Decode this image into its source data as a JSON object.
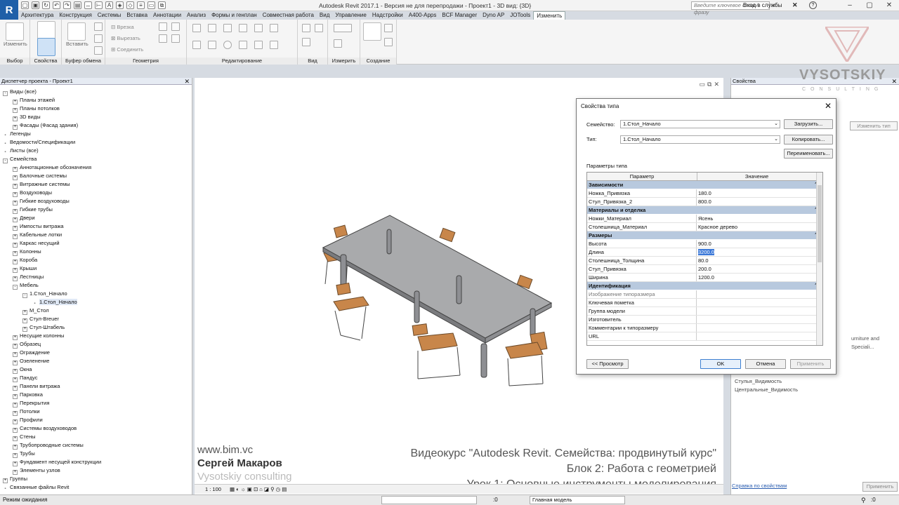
{
  "app": {
    "logo_letter": "R",
    "title": "Autodesk Revit 2017.1 - Версия не для перепродажи -   Проект1 - 3D вид: {3D}",
    "search_placeholder": "Введите ключевое слово/фразу",
    "login_label": "Вход в службы"
  },
  "ribbon": {
    "tabs": [
      "Архитектура",
      "Конструкция",
      "Системы",
      "Вставка",
      "Аннотации",
      "Анализ",
      "Формы и генплан",
      "Совместная работа",
      "Вид",
      "Управление",
      "Надстройки",
      "A400-Apps",
      "BCF Manager",
      "Dyno AP",
      "JOTools",
      "Изменить"
    ],
    "active_tab": "Изменить",
    "panels": {
      "select": "Выбор",
      "properties": "Свойства",
      "clipboard": "Буфер обмена",
      "geometry": "Геометрия",
      "modify": "Редактирование",
      "view": "Вид",
      "measure": "Измерить",
      "create": "Создание"
    },
    "buttons": {
      "modify": "Изменить",
      "paste": "Вставить",
      "cut_in": "Врезка",
      "cut": "Вырезать",
      "join": "Соединить"
    }
  },
  "browser": {
    "title": "Диспетчер проекта - Проект1",
    "nodes": [
      {
        "label": "Виды (все)",
        "level": 0,
        "exp": "-"
      },
      {
        "label": "Планы этажей",
        "level": 1,
        "exp": "+"
      },
      {
        "label": "Планы потолков",
        "level": 1,
        "exp": "+"
      },
      {
        "label": "3D виды",
        "level": 1,
        "exp": "+"
      },
      {
        "label": "Фасады (Фасад здания)",
        "level": 1,
        "exp": "+"
      },
      {
        "label": "Легенды",
        "level": 0,
        "exp": ""
      },
      {
        "label": "Ведомости/Спецификации",
        "level": 0,
        "exp": ""
      },
      {
        "label": "Листы (все)",
        "level": 0,
        "exp": ""
      },
      {
        "label": "Семейства",
        "level": 0,
        "exp": "-"
      },
      {
        "label": "Аннотационные обозначения",
        "level": 1,
        "exp": "+"
      },
      {
        "label": "Балочные системы",
        "level": 1,
        "exp": "+"
      },
      {
        "label": "Витражные системы",
        "level": 1,
        "exp": "+"
      },
      {
        "label": "Воздуховоды",
        "level": 1,
        "exp": "+"
      },
      {
        "label": "Гибкие воздуховоды",
        "level": 1,
        "exp": "+"
      },
      {
        "label": "Гибкие трубы",
        "level": 1,
        "exp": "+"
      },
      {
        "label": "Двери",
        "level": 1,
        "exp": "+"
      },
      {
        "label": "Импосты витража",
        "level": 1,
        "exp": "+"
      },
      {
        "label": "Кабельные лотки",
        "level": 1,
        "exp": "+"
      },
      {
        "label": "Каркас несущий",
        "level": 1,
        "exp": "+"
      },
      {
        "label": "Колонны",
        "level": 1,
        "exp": "+"
      },
      {
        "label": "Короба",
        "level": 1,
        "exp": "+"
      },
      {
        "label": "Крыши",
        "level": 1,
        "exp": "+"
      },
      {
        "label": "Лестницы",
        "level": 1,
        "exp": "+"
      },
      {
        "label": "Мебель",
        "level": 1,
        "exp": "-"
      },
      {
        "label": "1.Стол_Начало",
        "level": 2,
        "exp": "-"
      },
      {
        "label": "1.Стол_Начало",
        "level": 3,
        "exp": "",
        "selected": true
      },
      {
        "label": "М_Стол",
        "level": 2,
        "exp": "+"
      },
      {
        "label": "Стул-Breuer",
        "level": 2,
        "exp": "+"
      },
      {
        "label": "Стул-Штабель",
        "level": 2,
        "exp": "+"
      },
      {
        "label": "Несущие колонны",
        "level": 1,
        "exp": "+"
      },
      {
        "label": "Образец",
        "level": 1,
        "exp": "+"
      },
      {
        "label": "Ограждение",
        "level": 1,
        "exp": "+"
      },
      {
        "label": "Озеленение",
        "level": 1,
        "exp": "+"
      },
      {
        "label": "Окна",
        "level": 1,
        "exp": "+"
      },
      {
        "label": "Пандус",
        "level": 1,
        "exp": "+"
      },
      {
        "label": "Панели витража",
        "level": 1,
        "exp": "+"
      },
      {
        "label": "Парковка",
        "level": 1,
        "exp": "+"
      },
      {
        "label": "Перекрытия",
        "level": 1,
        "exp": "+"
      },
      {
        "label": "Потолки",
        "level": 1,
        "exp": "+"
      },
      {
        "label": "Профили",
        "level": 1,
        "exp": "+"
      },
      {
        "label": "Системы воздуховодов",
        "level": 1,
        "exp": "+"
      },
      {
        "label": "Стены",
        "level": 1,
        "exp": "+"
      },
      {
        "label": "Трубопроводные системы",
        "level": 1,
        "exp": "+"
      },
      {
        "label": "Трубы",
        "level": 1,
        "exp": "+"
      },
      {
        "label": "Фундамент несущей конструкции",
        "level": 1,
        "exp": "+"
      },
      {
        "label": "Элементы узлов",
        "level": 1,
        "exp": "+"
      },
      {
        "label": "Группы",
        "level": 0,
        "exp": "+"
      },
      {
        "label": "Связанные файлы Revit",
        "level": 0,
        "exp": ""
      }
    ]
  },
  "canvas": {
    "scale": "1 : 100",
    "watermark_url": "www.bim.vc",
    "watermark_author": "Сергей Макаров",
    "watermark_company": "Vysotskiy consulting",
    "course_title": "Видеокурс \"Autodesk Revit. Семейства: продвинутый курс\"",
    "course_block": "Блок 2: Работа с геометрией",
    "course_lesson": "Урок 1: Основные инструменты моделирования"
  },
  "properties": {
    "title": "Свойства",
    "logo": "VYSOTSKIY",
    "logo_sub": "CONSULTING",
    "edit_type": "Изменить тип",
    "visible_rows": [
      "Стулья_Видимость",
      "Центральные_Видимость"
    ],
    "partial_value": "urniture and Speciali...",
    "partial_material": "ебель",
    "help_link": "Справка по свойствам",
    "apply": "Применить"
  },
  "dialog": {
    "title": "Свойства типа",
    "family_label": "Семейство:",
    "family_value": "1.Стол_Начало",
    "type_label": "Тип:",
    "type_value": "1.Стол_Начало",
    "load_btn": "Загрузить...",
    "copy_btn": "Копировать...",
    "rename_btn": "Переименовать...",
    "params_label": "Параметры типа",
    "col_param": "Параметр",
    "col_value": "Значение",
    "groups": [
      {
        "name": "Зависимости",
        "rows": [
          {
            "name": "Ножка_Привязка",
            "value": "180.0"
          },
          {
            "name": "Стул_Привязка_2",
            "value": "800.0"
          }
        ]
      },
      {
        "name": "Материалы и отделка",
        "rows": [
          {
            "name": "Ножки_Материал",
            "value": "Ясень"
          },
          {
            "name": "Столешница_Материал",
            "value": "Красное дерево"
          }
        ]
      },
      {
        "name": "Размеры",
        "rows": [
          {
            "name": "Высота",
            "value": "900.0"
          },
          {
            "name": "Длина",
            "value": "3200.0",
            "selected": true
          },
          {
            "name": "Столешница_Толщина",
            "value": "80.0"
          },
          {
            "name": "Стул_Привязка",
            "value": "200.0"
          },
          {
            "name": "Ширина",
            "value": "1200.0"
          }
        ]
      },
      {
        "name": "Идентификация",
        "rows": [
          {
            "name": "Изображение типоразмера",
            "value": "",
            "muted": true
          },
          {
            "name": "Ключевая пометка",
            "value": ""
          },
          {
            "name": "Группа модели",
            "value": ""
          },
          {
            "name": "Изготовитель",
            "value": ""
          },
          {
            "name": "Комментарии к типоразмеру",
            "value": ""
          },
          {
            "name": "URL",
            "value": ""
          }
        ]
      }
    ],
    "preview_btn": "<< Просмотр",
    "ok_btn": "OK",
    "cancel_btn": "Отмена",
    "apply_btn": "Применить"
  },
  "status": {
    "text": "Режим ожидания",
    "zero": ":0",
    "model": "Главная модель"
  }
}
